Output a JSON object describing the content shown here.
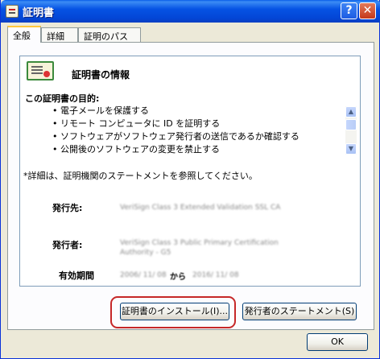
{
  "window": {
    "title": "証明書",
    "help_label": "?",
    "close_label": "✕"
  },
  "tabs": [
    {
      "label": "全般",
      "active": true
    },
    {
      "label": "詳細",
      "active": false
    },
    {
      "label": "証明のパス",
      "active": false
    }
  ],
  "info": {
    "heading": "証明書の情報",
    "purpose_title": "この証明書の目的:",
    "purposes": [
      "電子メールを保護する",
      "リモート コンピュータに ID を証明する",
      "ソフトウェアがソフトウェア発行者の送信であるか確認する",
      "公開後のソフトウェアの変更を禁止する"
    ],
    "note": "*詳細は、証明機関のステートメントを参照してください。",
    "issued_to_label": "発行先:",
    "issued_to_value": "VeriSign Class 3 Extended Validation SSL CA",
    "issued_by_label": "発行者:",
    "issued_by_value": "VeriSign Class 3 Public Primary Certification Authority - G5",
    "valid_label": "有効期間",
    "valid_from": "2006/ 11/ 08",
    "valid_kara": "から",
    "valid_to": "2016/ 11/ 08"
  },
  "buttons": {
    "install": "証明書のインストール(I)...",
    "statement": "発行者のステートメント(S)",
    "ok": "OK"
  },
  "icons": [
    "certificate-icon",
    "scroll-up-icon",
    "scroll-down-icon"
  ],
  "colors": {
    "titlebar": "#0653e4",
    "highlight": "#c62828"
  }
}
